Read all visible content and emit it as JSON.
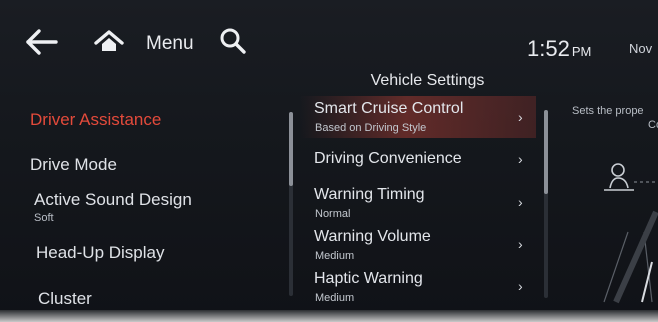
{
  "topbar": {
    "menu_label": "Menu",
    "time": "1:52",
    "ampm": "PM",
    "date": "Nov"
  },
  "screen_title": "Vehicle Settings",
  "categories": [
    {
      "label": "Driver Assistance",
      "sub": "",
      "active": true
    },
    {
      "label": "Drive Mode",
      "sub": ""
    },
    {
      "label": "Active Sound Design",
      "sub": "Soft"
    },
    {
      "label": "Head-Up Display",
      "sub": ""
    },
    {
      "label": "Cluster",
      "sub": ""
    }
  ],
  "settings": [
    {
      "label": "Smart Cruise Control",
      "sub": "Based on Driving Style",
      "selected": true
    },
    {
      "label": "Driving Convenience",
      "sub": ""
    },
    {
      "label": "Warning Timing",
      "sub": "Normal"
    },
    {
      "label": "Warning Volume",
      "sub": "Medium"
    },
    {
      "label": "Haptic Warning",
      "sub": "Medium"
    }
  ],
  "description": {
    "line1": "Sets the prope",
    "line2": "Con"
  },
  "icons": {
    "back": "arrow-left-icon",
    "home": "home-icon",
    "search": "search-icon",
    "chevron": "chevron-right-icon",
    "illustration": "car-driver-illustration"
  },
  "colors": {
    "accent_red": "#e34a3b",
    "selected_row": "#a03a32"
  }
}
